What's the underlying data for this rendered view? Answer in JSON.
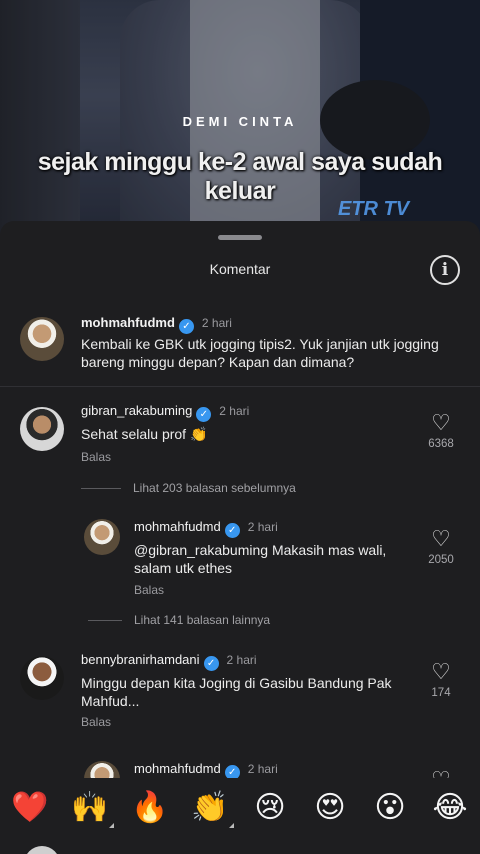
{
  "video": {
    "overlay_small": "DEMI CINTA",
    "overlay_caption": "sejak minggu ke-2 awal saya sudah keluar",
    "channel_logo": "ETR TV"
  },
  "sheet": {
    "title": "Komentar",
    "info_icon": "info-icon"
  },
  "caption_post": {
    "username": "mohmahfudmd",
    "time": "2 hari",
    "text": "Kembali ke GBK utk jogging tipis2. Yuk janjian utk jogging bareng minggu depan? Kapan dan dimana?"
  },
  "comments": [
    {
      "username": "gibran_rakabuming",
      "time": "2 hari",
      "text": "Sehat selalu prof 👏",
      "reply_label": "Balas",
      "likes": "6368",
      "view_replies": "Lihat 203 balasan sebelumnya"
    },
    {
      "username": "mohmahfudmd",
      "time": "2 hari",
      "text": "@gibran_rakabuming Makasih mas wali, salam utk ethes",
      "reply_label": "Balas",
      "likes": "2050",
      "view_replies": "Lihat 141 balasan lainnya"
    },
    {
      "username": "bennybranirhamdani",
      "time": "2 hari",
      "text": "Minggu depan kita Joging di Gasibu Bandung Pak Mahfud...",
      "reply_label": "Balas",
      "likes": "174"
    },
    {
      "username": "mohmahfudmd",
      "time": "2 hari"
    }
  ],
  "emoji_bar": [
    "❤️",
    "🙌",
    "🔥",
    "👏",
    "😢",
    "😍",
    "😮",
    "😂"
  ],
  "colors": {
    "sheet_bg": "#1e1e20",
    "verified": "#3897f0",
    "heart_emoji": "#e0245e"
  }
}
